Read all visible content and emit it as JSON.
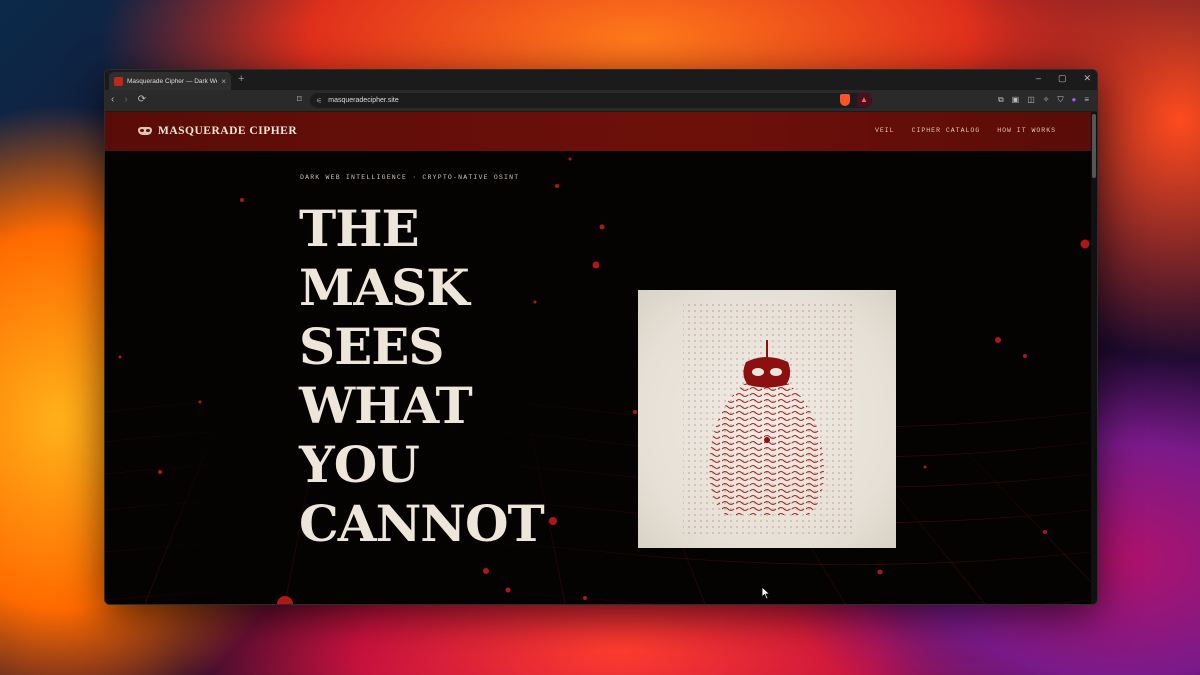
{
  "browser": {
    "tab_title": "Masquerade Cipher — Dark Web",
    "tab_close": "×",
    "new_tab": "+",
    "window_controls": [
      "–",
      "▢",
      "✕"
    ],
    "url": "masqueradecipher.site",
    "nav_icons": [
      "back-icon",
      "forward-icon",
      "reload-icon",
      "bookmark-icon"
    ],
    "extension_icons": [
      "extensions-icon",
      "sidebar-icon",
      "split-view-icon",
      "leo-icon",
      "vpn-icon",
      "wallet-icon",
      "menu-icon"
    ]
  },
  "site": {
    "brand": "MASQUERADE CIPHER",
    "nav": [
      "VEIL",
      "CIPHER CATALOG",
      "HOW IT WORKS"
    ],
    "eyebrow": "DARK WEB INTELLIGENCE · CRYPTO-NATIVE OSINT",
    "headline": [
      "THE",
      "MASK",
      "SEES",
      "WHAT",
      "YOU",
      "CANNOT"
    ],
    "colors": {
      "header": "#6e100a",
      "accent_red": "#b01818",
      "headline": "#efe6da",
      "background": "#050202"
    }
  }
}
